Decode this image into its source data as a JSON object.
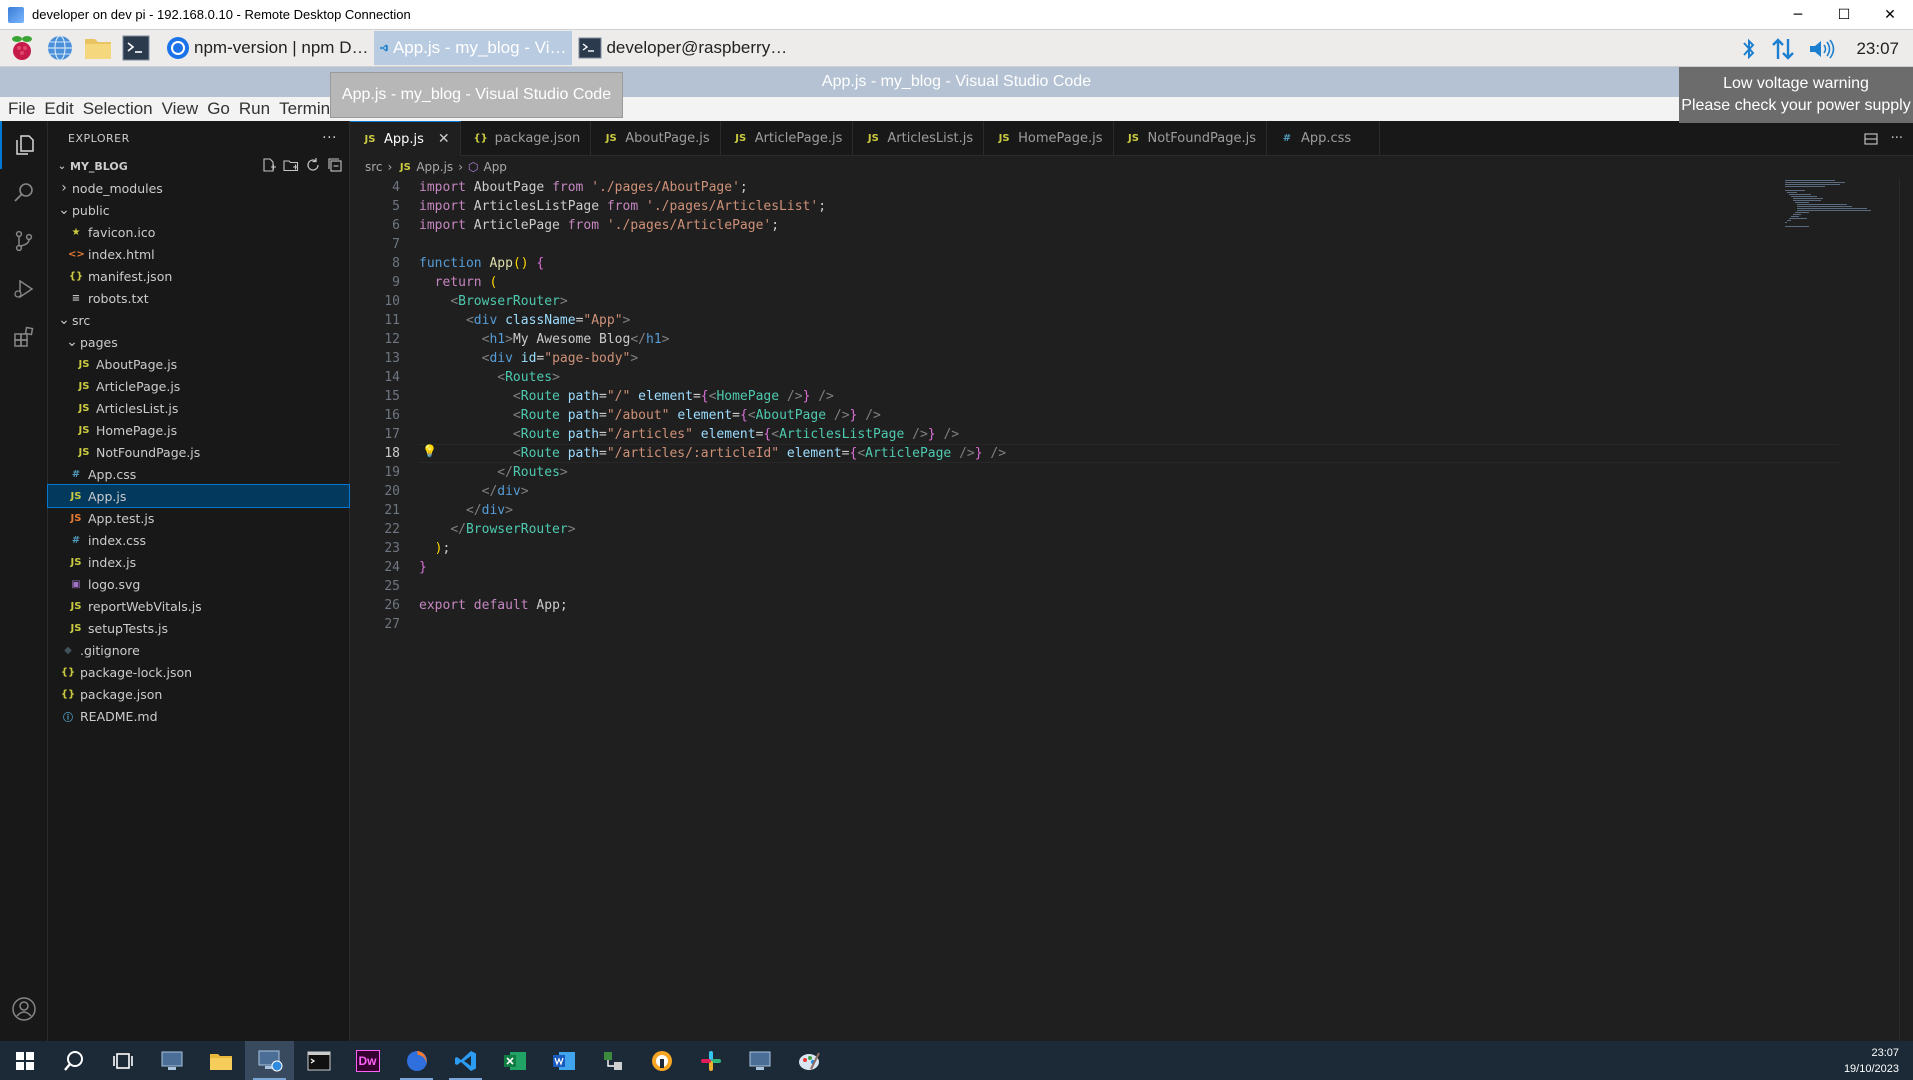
{
  "rdp": {
    "title": "developer on dev pi - 192.168.0.10 - Remote Desktop Connection",
    "minimize": "─",
    "maximize": "☐",
    "close": "✕"
  },
  "pi_taskbar": {
    "tasks": [
      {
        "label": "npm-version | npm D…"
      },
      {
        "label": "App.js - my_blog - Vi…"
      },
      {
        "label": "developer@raspberry…"
      }
    ],
    "clock": "23:07"
  },
  "vscode": {
    "window_title": "App.js - my_blog - Visual Studio Code",
    "tooltip": "App.js - my_blog - Visual Studio Code",
    "voltage_warning": {
      "line1": "Low voltage warning",
      "line2": "Please check your power supply"
    },
    "menu": [
      "File",
      "Edit",
      "Selection",
      "View",
      "Go",
      "Run",
      "Termina"
    ],
    "sidebar": {
      "header": "EXPLORER",
      "more": "···",
      "project": "MY_BLOG",
      "tree": [
        {
          "label": "node_modules",
          "type": "folder",
          "depth": 1,
          "open": false
        },
        {
          "label": "public",
          "type": "folder",
          "depth": 1,
          "open": true
        },
        {
          "label": "favicon.ico",
          "type": "ico",
          "depth": 2
        },
        {
          "label": "index.html",
          "type": "html",
          "depth": 2
        },
        {
          "label": "manifest.json",
          "type": "json",
          "depth": 2
        },
        {
          "label": "robots.txt",
          "type": "txt",
          "depth": 2
        },
        {
          "label": "src",
          "type": "folder",
          "depth": 1,
          "open": true
        },
        {
          "label": "pages",
          "type": "folder",
          "depth": 2,
          "open": true
        },
        {
          "label": "AboutPage.js",
          "type": "js",
          "depth": 3
        },
        {
          "label": "ArticlePage.js",
          "type": "js",
          "depth": 3
        },
        {
          "label": "ArticlesList.js",
          "type": "js",
          "depth": 3
        },
        {
          "label": "HomePage.js",
          "type": "js",
          "depth": 3
        },
        {
          "label": "NotFoundPage.js",
          "type": "js",
          "depth": 3
        },
        {
          "label": "App.css",
          "type": "css",
          "depth": 2
        },
        {
          "label": "App.js",
          "type": "js",
          "depth": 2,
          "selected": true
        },
        {
          "label": "App.test.js",
          "type": "test",
          "depth": 2
        },
        {
          "label": "index.css",
          "type": "css",
          "depth": 2
        },
        {
          "label": "index.js",
          "type": "js",
          "depth": 2
        },
        {
          "label": "logo.svg",
          "type": "svg",
          "depth": 2
        },
        {
          "label": "reportWebVitals.js",
          "type": "js",
          "depth": 2
        },
        {
          "label": "setupTests.js",
          "type": "js",
          "depth": 2
        },
        {
          "label": ".gitignore",
          "type": "git",
          "depth": 1
        },
        {
          "label": "package-lock.json",
          "type": "json",
          "depth": 1
        },
        {
          "label": "package.json",
          "type": "json",
          "depth": 1
        },
        {
          "label": "README.md",
          "type": "md",
          "depth": 1
        }
      ]
    },
    "tabs": [
      {
        "label": "App.js",
        "type": "js",
        "active": true
      },
      {
        "label": "package.json",
        "type": "json"
      },
      {
        "label": "AboutPage.js",
        "type": "js"
      },
      {
        "label": "ArticlePage.js",
        "type": "js"
      },
      {
        "label": "ArticlesList.js",
        "type": "js"
      },
      {
        "label": "HomePage.js",
        "type": "js"
      },
      {
        "label": "NotFoundPage.js",
        "type": "js"
      },
      {
        "label": "App.css",
        "type": "css"
      }
    ],
    "tab_close": "✕",
    "breadcrumb": {
      "folder": "src",
      "file": "App.js",
      "symbol": "App"
    },
    "current_line": 18,
    "line_numbers": [
      4,
      5,
      6,
      7,
      8,
      9,
      10,
      11,
      12,
      13,
      14,
      15,
      16,
      17,
      18,
      19,
      20,
      21,
      22,
      23,
      24,
      25,
      26,
      27
    ],
    "code_lines": [
      "import AboutPage from './pages/AboutPage';",
      "import ArticlesListPage from './pages/ArticlesList';",
      "import ArticlePage from './pages/ArticlePage';",
      "",
      "function App() {",
      "  return (",
      "    <BrowserRouter>",
      "      <div className=\"App\">",
      "        <h1>My Awesome Blog</h1>",
      "        <div id=\"page-body\">",
      "          <Routes>",
      "            <Route path=\"/\" element={<HomePage />} />",
      "            <Route path=\"/about\" element={<AboutPage />} />",
      "            <Route path=\"/articles\" element={<ArticlesListPage />} />",
      "            <Route path=\"/articles/:articleId\" element={<ArticlePage />} />",
      "          </Routes>",
      "        </div>",
      "      </div>",
      "    </BrowserRouter>",
      "  );",
      "}",
      "",
      "export default App;",
      ""
    ]
  },
  "windows": {
    "clock_time": "23:07",
    "clock_date": "19/10/2023",
    "apps": [
      "start",
      "search",
      "task-view",
      "remote-desktop-1",
      "file-explorer",
      "remote-desktop-2",
      "terminal",
      "dreamweaver",
      "firefox",
      "vscode",
      "excel",
      "word",
      "network",
      "app-circle",
      "slack",
      "remote-desktop-3",
      "paint"
    ],
    "dw_label": "Dw"
  }
}
